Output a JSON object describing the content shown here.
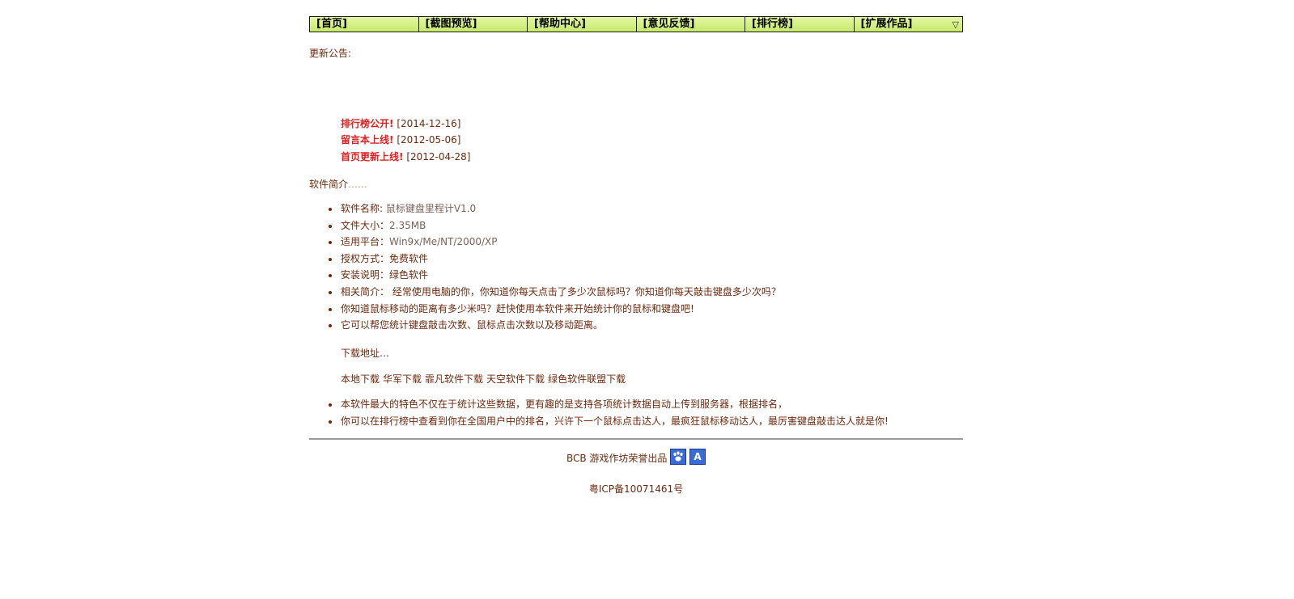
{
  "nav": {
    "items": [
      {
        "label": "[首页]"
      },
      {
        "label": "[截图预览]"
      },
      {
        "label": "[帮助中心]"
      },
      {
        "label": "[意见反馈]"
      },
      {
        "label": "[排行榜]"
      },
      {
        "label": "[扩展作品]"
      }
    ],
    "dropdown_arrow": "▽"
  },
  "announcement": {
    "heading": "更新公告:",
    "items": [
      {
        "title": "排行榜公开!",
        "date": "[2014-12-16]"
      },
      {
        "title": "留言本上线!",
        "date": "[2012-05-06]"
      },
      {
        "title": "首页更新上线!",
        "date": "[2012-04-28]"
      }
    ]
  },
  "intro": {
    "heading": "软件简介",
    "ellipsis": "……",
    "features": [
      {
        "k": "软件名称: ",
        "v": "鼠标键盘里程计V1.0"
      },
      {
        "k": "文件大小：",
        "v": "2.35MB"
      },
      {
        "k": "适用平台：",
        "v": "Win9x/Me/NT/2000/XP"
      },
      {
        "k": "授权方式：",
        "v": "免费软件"
      },
      {
        "k": "安装说明：",
        "v": "绿色软件"
      },
      {
        "k": "相关简介：",
        "v": " 经常使用电脑的你，你知道你每天点击了多少次鼠标吗？你知道你每天敲击键盘多少次吗？"
      },
      {
        "k": "",
        "v": "你知道鼠标移动的距离有多少米吗？赶快使用本软件来开始统计你的鼠标和键盘吧!"
      },
      {
        "k": "",
        "v": "它可以帮您统计键盘敲击次数、鼠标点击次数以及移动距离。"
      }
    ],
    "download_heading": "下载地址…",
    "downloads": [
      "本地下载",
      "华军下载",
      "霏凡软件下载",
      "天空软件下载",
      "绿色软件联盟下载"
    ],
    "extra": [
      "本软件最大的特色不仅在于统计这些数据，更有趣的是支持各项统计数据自动上传到服务器，根据排名，",
      "你可以在排行榜中查看到你在全国用户中的排名，兴许下一个鼠标点击达人，最疯狂鼠标移动达人，最厉害键盘敲击达人就是你!"
    ]
  },
  "footer": {
    "credit": "BCB 游戏作坊荣誉出品",
    "icon1": "paw-icon",
    "icon2_glyph": "A",
    "icp": "粤ICP备10071461号"
  },
  "colors": {
    "text": "#6b2a0e",
    "highlight": "#e02020",
    "nav_bg": "#d4ef84"
  }
}
